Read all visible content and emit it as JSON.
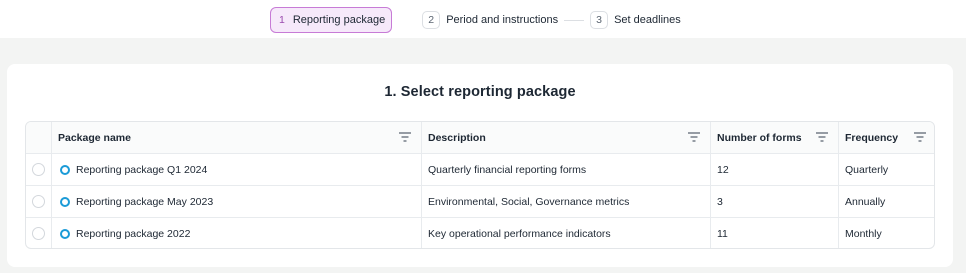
{
  "stepper": {
    "steps": [
      {
        "num": "1",
        "label": "Reporting package",
        "active": true
      },
      {
        "num": "2",
        "label": "Period and instructions",
        "active": false
      },
      {
        "num": "3",
        "label": "Set deadlines",
        "active": false
      }
    ]
  },
  "main": {
    "title": "1. Select reporting package",
    "table": {
      "columns": [
        "Package name",
        "Description",
        "Number of forms",
        "Frequency"
      ],
      "rows": [
        {
          "name": "Reporting package Q1 2024",
          "description": "Quarterly financial reporting forms",
          "forms": "12",
          "frequency": "Quarterly"
        },
        {
          "name": "Reporting package May 2023",
          "description": "Environmental, Social, Governance metrics",
          "forms": "3",
          "frequency": "Annually"
        },
        {
          "name": "Reporting package 2022",
          "description": "Key operational performance indicators",
          "forms": "11",
          "frequency": "Monthly"
        }
      ]
    }
  },
  "icons": {
    "filter": "filter-icon",
    "package": "package-status-icon",
    "accent": "#1b9bd7",
    "active_step": "#c77bd6"
  }
}
